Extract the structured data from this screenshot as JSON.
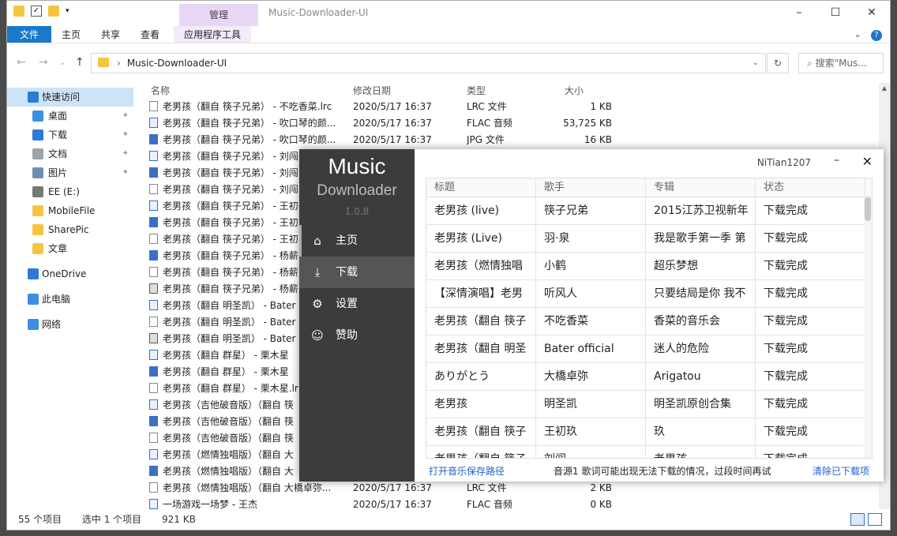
{
  "explorer": {
    "title": "Music-Downloader-UI",
    "context_tab": "管理",
    "ribbon_tabs": [
      "文件",
      "主页",
      "共享",
      "查看",
      "应用程序工具"
    ],
    "address_path": "Music-Downloader-UI",
    "search_placeholder": "搜索\"Mus...",
    "columns": [
      "名称",
      "修改日期",
      "类型",
      "大小"
    ],
    "sidebar": [
      {
        "label": "快速访问",
        "icon": "star-icon",
        "level": 0,
        "active": true,
        "pinned": false
      },
      {
        "label": "桌面",
        "icon": "desktop-icon",
        "level": 1,
        "pinned": true
      },
      {
        "label": "下载",
        "icon": "download-icon",
        "level": 1,
        "pinned": true
      },
      {
        "label": "文档",
        "icon": "document-icon",
        "level": 1,
        "pinned": true
      },
      {
        "label": "图片",
        "icon": "picture-icon",
        "level": 1,
        "pinned": true
      },
      {
        "label": "EE (E:)",
        "icon": "drive-icon",
        "level": 1,
        "pinned": false
      },
      {
        "label": "MobileFile",
        "icon": "folder-icon",
        "level": 1,
        "pinned": false
      },
      {
        "label": "SharePic",
        "icon": "folder-icon",
        "level": 1,
        "pinned": false
      },
      {
        "label": "文章",
        "icon": "folder-icon",
        "level": 1,
        "pinned": false
      },
      {
        "label": "",
        "icon": "",
        "level": -1
      },
      {
        "label": "OneDrive",
        "icon": "cloud-icon",
        "level": 0,
        "pinned": false
      },
      {
        "label": "",
        "icon": "",
        "level": -1
      },
      {
        "label": "此电脑",
        "icon": "computer-icon",
        "level": 0,
        "pinned": false
      },
      {
        "label": "",
        "icon": "",
        "level": -1
      },
      {
        "label": "网络",
        "icon": "network-icon",
        "level": 0,
        "pinned": false
      }
    ],
    "files": [
      {
        "name": "老男孩（翻自 筷子兄弟） - 不吃香菜.lrc",
        "date": "2020/5/17 16:37",
        "type": "LRC 文件",
        "size": "1 KB",
        "icon": "file"
      },
      {
        "name": "老男孩（翻自 筷子兄弟） - 吹口琴的颜...",
        "date": "2020/5/17 16:37",
        "type": "FLAC 音频",
        "size": "53,725 KB",
        "icon": "audio"
      },
      {
        "name": "老男孩（翻自 筷子兄弟） - 吹口琴的颜...",
        "date": "2020/5/17 16:37",
        "type": "JPG 文件",
        "size": "16 KB",
        "icon": "img"
      },
      {
        "name": "老男孩（翻自 筷子兄弟） - 刘闯",
        "date": "",
        "type": "",
        "size": "",
        "icon": "audio"
      },
      {
        "name": "老男孩（翻自 筷子兄弟） - 刘闯",
        "date": "",
        "type": "",
        "size": "",
        "icon": "img"
      },
      {
        "name": "老男孩（翻自 筷子兄弟） - 刘闯",
        "date": "",
        "type": "",
        "size": "",
        "icon": "file"
      },
      {
        "name": "老男孩（翻自 筷子兄弟） - 王初",
        "date": "",
        "type": "",
        "size": "",
        "icon": "audio"
      },
      {
        "name": "老男孩（翻自 筷子兄弟） - 王初",
        "date": "",
        "type": "",
        "size": "",
        "icon": "img"
      },
      {
        "name": "老男孩（翻自 筷子兄弟） - 王初",
        "date": "",
        "type": "",
        "size": "",
        "icon": "file"
      },
      {
        "name": "老男孩（翻自 筷子兄弟） - 杨薪",
        "date": "",
        "type": "",
        "size": "",
        "icon": "img"
      },
      {
        "name": "老男孩（翻自 筷子兄弟） - 杨薪",
        "date": "",
        "type": "",
        "size": "",
        "icon": "file"
      },
      {
        "name": "老男孩（翻自 筷子兄弟） - 杨薪",
        "date": "",
        "type": "",
        "size": "",
        "icon": "disc"
      },
      {
        "name": "老男孩（翻自 明圣凯） - Bater",
        "date": "",
        "type": "",
        "size": "",
        "icon": "audio"
      },
      {
        "name": "老男孩（翻自 明圣凯） - Bater",
        "date": "",
        "type": "",
        "size": "",
        "icon": "file"
      },
      {
        "name": "老男孩（翻自 明圣凯） - Bater",
        "date": "",
        "type": "",
        "size": "",
        "icon": "disc"
      },
      {
        "name": "老男孩（翻自 群星） - 栗木星",
        "date": "",
        "type": "",
        "size": "",
        "icon": "audio"
      },
      {
        "name": "老男孩（翻自 群星） - 栗木星",
        "date": "",
        "type": "",
        "size": "",
        "icon": "img"
      },
      {
        "name": "老男孩（翻自 群星） - 栗木星.lr",
        "date": "",
        "type": "",
        "size": "",
        "icon": "file"
      },
      {
        "name": "老男孩（吉他破音版）（翻自 筷",
        "date": "",
        "type": "",
        "size": "",
        "icon": "audio"
      },
      {
        "name": "老男孩（吉他破音版）（翻自 筷",
        "date": "",
        "type": "",
        "size": "",
        "icon": "img"
      },
      {
        "name": "老男孩（吉他破音版）（翻自 筷",
        "date": "",
        "type": "",
        "size": "",
        "icon": "file"
      },
      {
        "name": "老男孩（燃情独唱版）（翻自 大",
        "date": "",
        "type": "",
        "size": "",
        "icon": "audio"
      },
      {
        "name": "老男孩（燃情独唱版）（翻自 大",
        "date": "",
        "type": "",
        "size": "",
        "icon": "img"
      },
      {
        "name": "老男孩（燃情独唱版）（翻自 大橋卓弥...",
        "date": "2020/5/17 16:37",
        "type": "LRC 文件",
        "size": "2 KB",
        "icon": "file"
      },
      {
        "name": "一场游戏一场梦 - 王杰",
        "date": "2020/5/17 16:37",
        "type": "FLAC 音频",
        "size": "0 KB",
        "icon": "audio"
      }
    ],
    "status": {
      "count": "55 个项目",
      "selected": "选中 1 个项目",
      "size": "921 KB"
    }
  },
  "app": {
    "logo_line1": "Music",
    "logo_line2": "Downloader",
    "version": "1.0.8",
    "user": "NiTian1207",
    "minimize": "–",
    "close": "✕",
    "menu": [
      {
        "label": "主页",
        "icon": "home-icon",
        "glyph": "⌂",
        "selected": false
      },
      {
        "label": "下载",
        "icon": "download-icon",
        "glyph": "⤓",
        "selected": true
      },
      {
        "label": "设置",
        "icon": "gear-icon",
        "glyph": "⚙",
        "selected": false
      },
      {
        "label": "赞助",
        "icon": "smiley-icon",
        "glyph": "☺",
        "selected": false
      }
    ],
    "columns": [
      "标题",
      "歌手",
      "专辑",
      "状态"
    ],
    "rows": [
      [
        "老男孩 (live)",
        "筷子兄弟",
        "2015江苏卫视新年",
        "下载完成"
      ],
      [
        "老男孩 (Live)",
        "羽·泉",
        "我是歌手第一季 第",
        "下载完成"
      ],
      [
        "老男孩（燃情独唱",
        "小鹤",
        "超乐梦想",
        "下载完成"
      ],
      [
        "【深情演唱】老男",
        "听风人",
        "只要结局是你 我不",
        "下载完成"
      ],
      [
        "老男孩（翻自 筷子",
        "不吃香菜",
        "香菜的音乐会",
        "下载完成"
      ],
      [
        "老男孩（翻自 明圣",
        "Bater official",
        "迷人的危险",
        "下载完成"
      ],
      [
        "ありがとう",
        "大橋卓弥",
        "Arigatou",
        "下载完成"
      ],
      [
        "老男孩",
        "明圣凯",
        "明圣凯原创合集",
        "下载完成"
      ],
      [
        "老男孩（翻自 筷子",
        "王初玖",
        "玖",
        "下载完成"
      ],
      [
        "老男孩（翻自 筷子",
        "刘闯",
        "老男孩",
        "下载完成"
      ]
    ],
    "footer": {
      "open_path": "打开音乐保存路径",
      "note": "音源1 歌词可能出现无法下载的情况，过段时间再试",
      "clear": "清除已下载项"
    }
  }
}
